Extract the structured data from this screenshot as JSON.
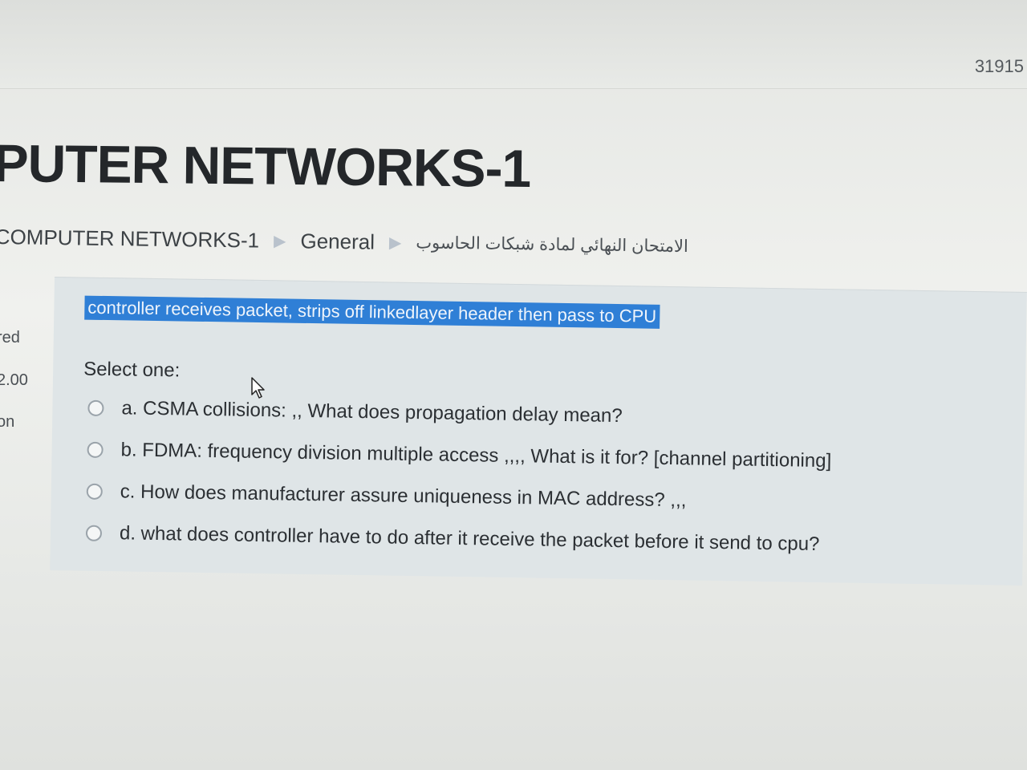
{
  "counter": "31915",
  "course_title": "PUTER NETWORKS-1",
  "breadcrumb": {
    "course": "COMPUTER NETWORKS-1",
    "section": "General",
    "exam": "الامتحان النهائي لمادة شبكات الحاسوب"
  },
  "side_info": {
    "status": "red",
    "mark": "2.00",
    "flag": "on"
  },
  "question": {
    "text": "controller receives packet, strips off linkedlayer header then pass to CPU",
    "select_label": "Select one:",
    "options": [
      {
        "label": "a. CSMA collisions: ,, What does propagation delay mean?"
      },
      {
        "label": "b. FDMA: frequency division multiple access ,,,, What is it for? [channel partitioning]"
      },
      {
        "label": "c. How does manufacturer assure uniqueness in MAC address? ,,,"
      },
      {
        "label": "d. what does controller have to do after it receive the packet before it send to cpu?"
      }
    ]
  },
  "colors": {
    "highlight": "#2f7fd6",
    "panel": "#dfe5e7"
  },
  "icons": {
    "cursor": "mouse-pointer-icon",
    "breadcrumb_separator": "triangle-right-icon"
  }
}
